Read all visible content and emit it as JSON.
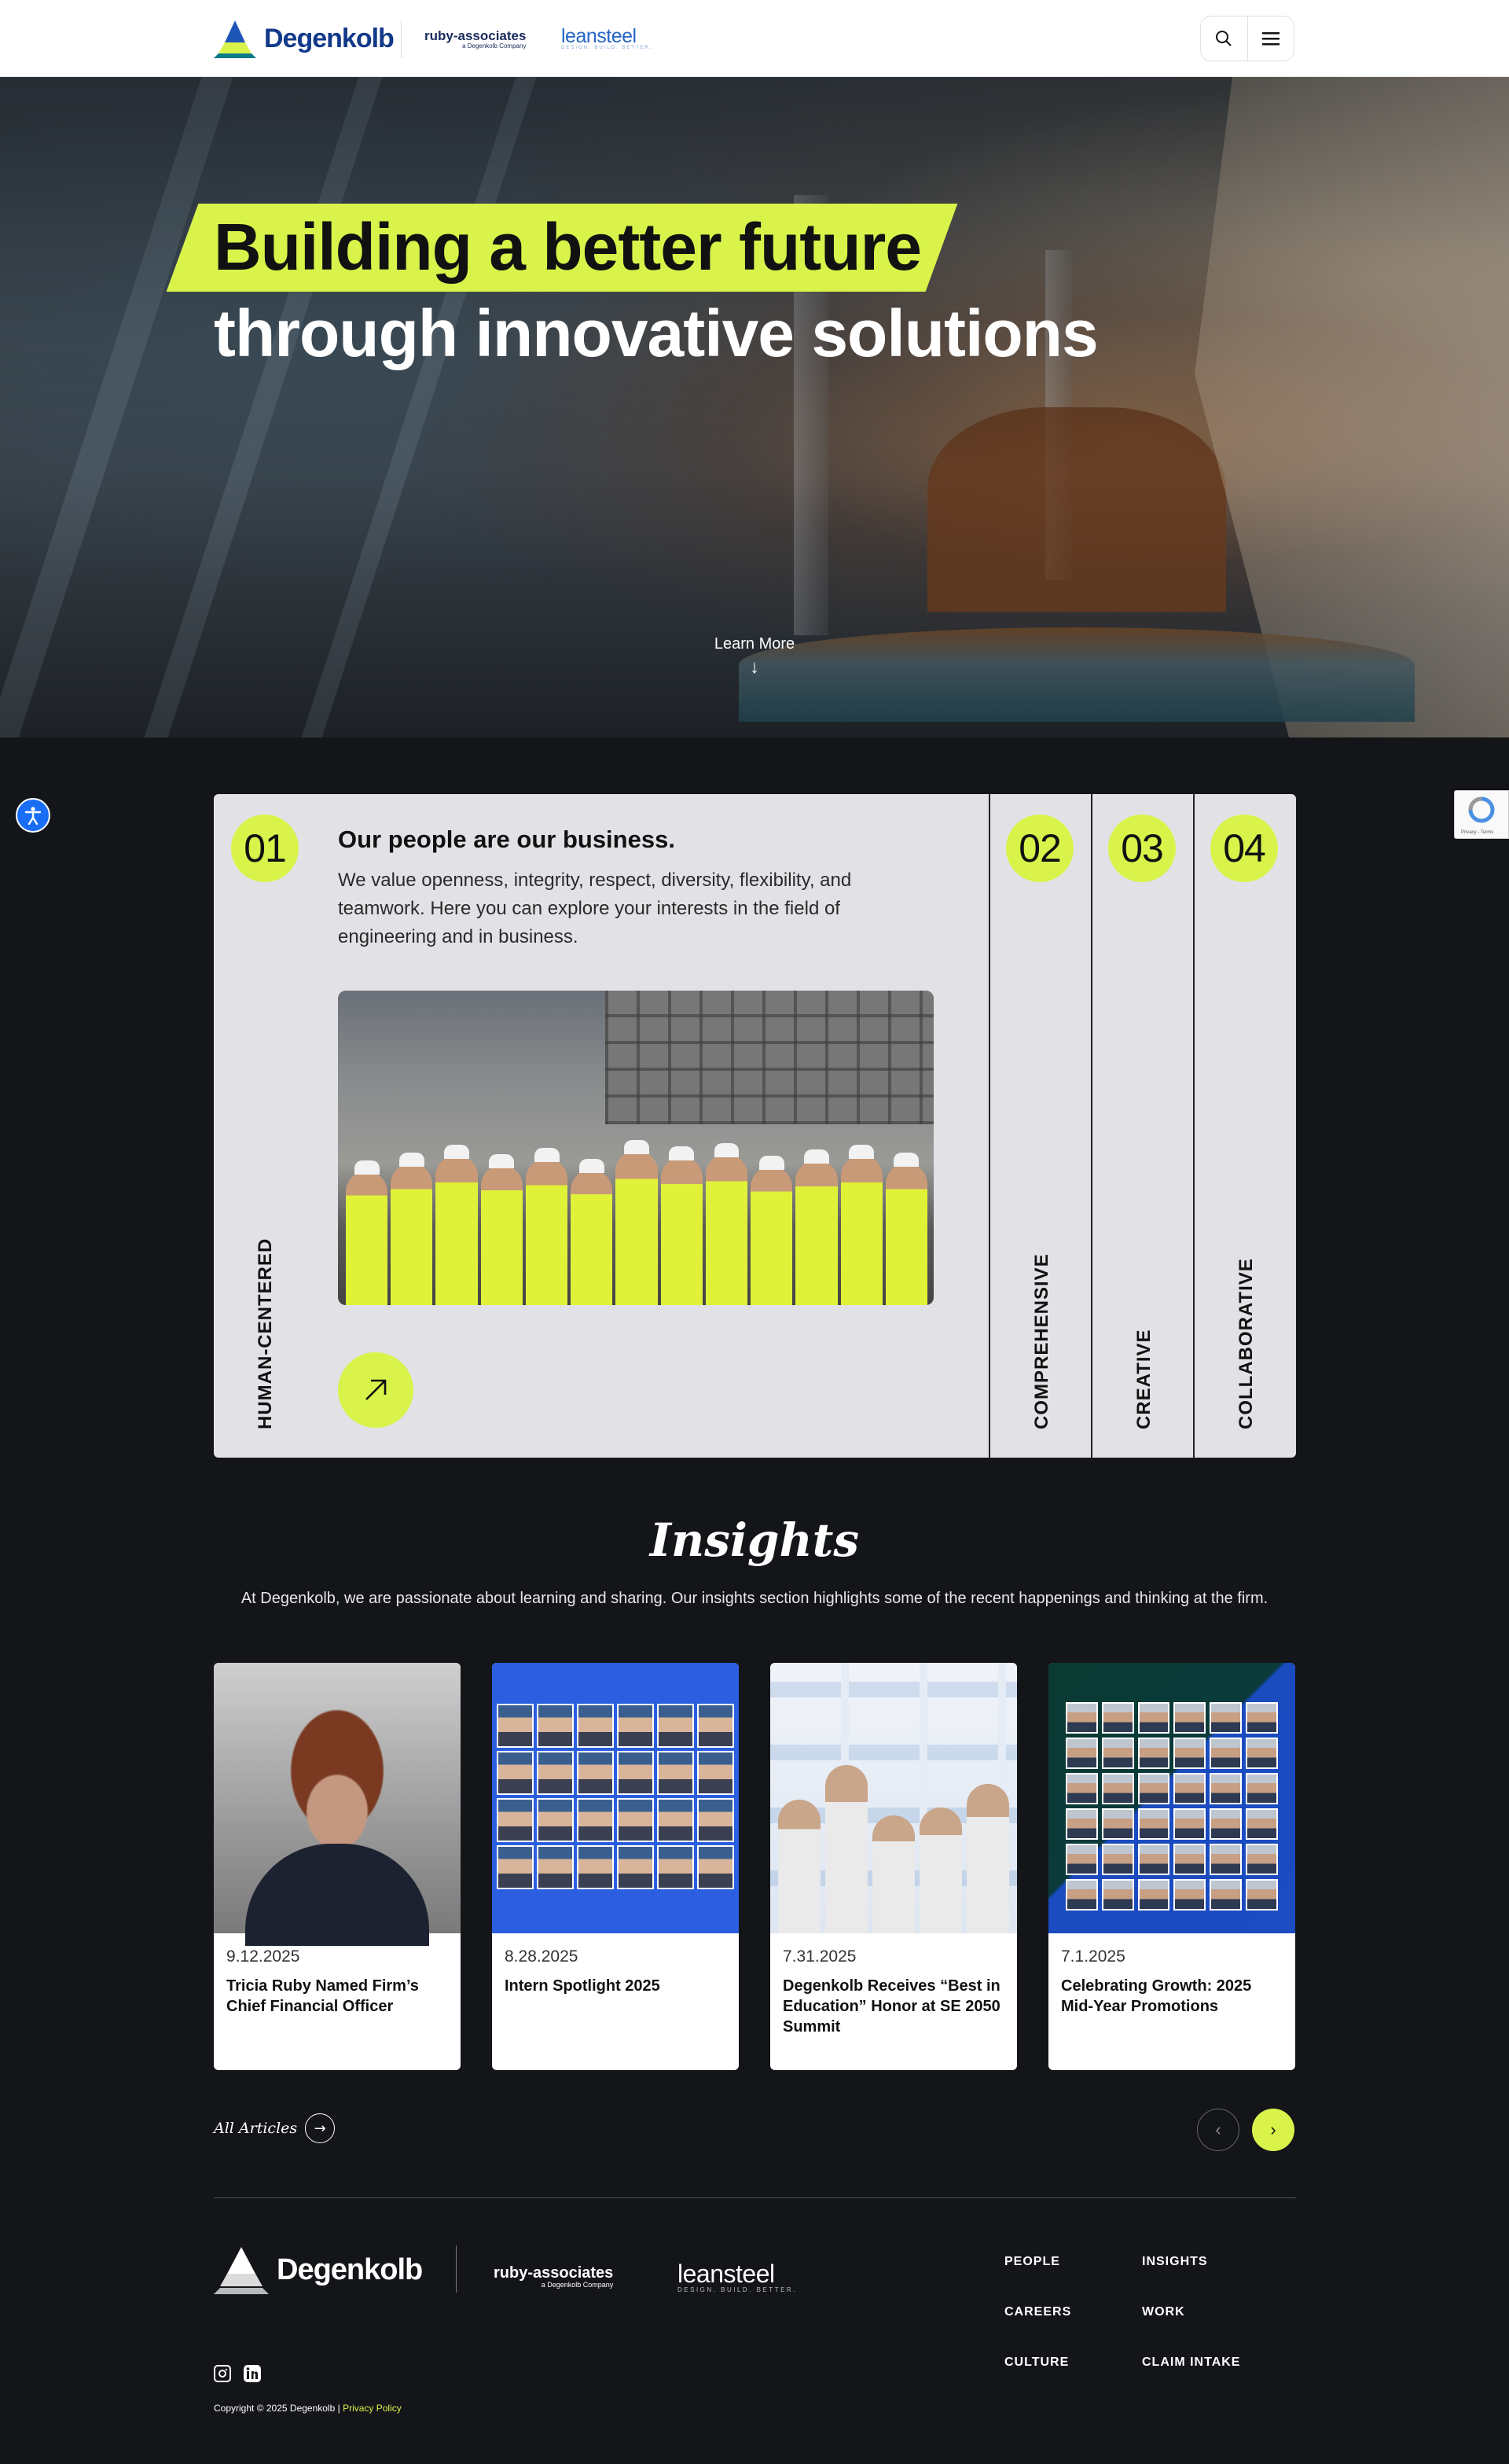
{
  "header": {
    "brand": "Degenkolb",
    "ruby": "ruby-associates",
    "ruby_sub": "a Degenkolb Company",
    "leansteel": "leansteel",
    "leansteel_sub": "DESIGN. BUILD. BETTER.",
    "actions": [
      {
        "icon": "search-icon"
      },
      {
        "icon": "menu-icon"
      }
    ]
  },
  "hero": {
    "title_line1": "Building a better future",
    "title_line2": "through innovative solutions",
    "learn_more": "Learn More",
    "learn_arrow": "↓"
  },
  "values": {
    "active": {
      "number": "01",
      "label": "HUMAN-CENTERED",
      "title": "Our people are our business.",
      "description": "We value openness, integrity, respect, diversity, flexibility, and teamwork. Here you can explore your interests in the field of engineering and in business."
    },
    "tabs": [
      {
        "number": "02",
        "label": "COMPREHENSIVE"
      },
      {
        "number": "03",
        "label": "CREATIVE"
      },
      {
        "number": "04",
        "label": "COLLABORATIVE"
      }
    ]
  },
  "insights": {
    "title": "Insights",
    "subtitle": "At Degenkolb, we are passionate about learning and sharing. Our insights section highlights some of the recent happenings and thinking at the firm.",
    "articles": [
      {
        "date": "9.12.2025",
        "title": "Tricia Ruby Named Firm’s Chief Financial Officer"
      },
      {
        "date": "8.28.2025",
        "title": "Intern Spotlight 2025"
      },
      {
        "date": "7.31.2025",
        "title": "Degenkolb Receives “Best in Education” Honor at SE 2050 Summit"
      },
      {
        "date": "7.1.2025",
        "title": "Celebrating Growth: 2025 Mid-Year Promotions"
      }
    ],
    "all_articles": "All Articles",
    "prev": "‹",
    "next": "›"
  },
  "footer": {
    "brand": "Degenkolb",
    "ruby": "ruby-associates",
    "ruby_sub": "a Degenkolb Company",
    "leansteel": "leansteel",
    "leansteel_sub": "DESIGN. BUILD. BETTER.",
    "links": [
      "PEOPLE",
      "INSIGHTS",
      "CAREERS",
      "WORK",
      "CULTURE",
      "CLAIM INTAKE"
    ],
    "social": [
      "instagram-icon",
      "linkedin-icon"
    ],
    "copyright": "Copyright © 2025 Degenkolb | ",
    "privacy": "Privacy Policy"
  },
  "colors": {
    "accent": "#d9f34a",
    "background": "#131519",
    "brand_blue": "#123a8a"
  }
}
